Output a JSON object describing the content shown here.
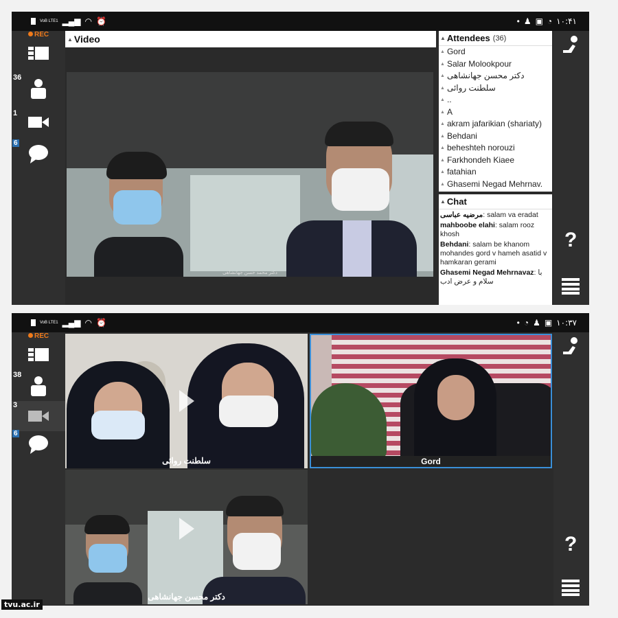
{
  "screenshot1": {
    "status_time": "۱۰:۴۱",
    "status_network": "VoB LTE1",
    "rec_label": "REC",
    "sidebar": {
      "attendee_count": "36",
      "camera_count": "1",
      "chat_badge": "6"
    },
    "video_header": "Video",
    "video_caption": "دکتر محمد حسن جهانشاهی",
    "attendees": {
      "title": "Attendees",
      "count": "(36)",
      "items": [
        "Gord",
        "Salar Molookpour",
        "دکتر محسن جهانشاهی",
        "سلطنت روائی",
        "..",
        "A",
        "akram jafarikian (shariaty)",
        "Behdani",
        "beheshteh norouzi",
        "Farkhondeh Kiaee",
        "fatahian",
        "Ghasemi Negad Mehrnav."
      ]
    },
    "chat": {
      "title": "Chat",
      "messages": [
        {
          "user": "مرضیه عباسی",
          "text": ": salam va eradat"
        },
        {
          "user": "mahboobe elahi",
          "text": ": salam rooz khosh"
        },
        {
          "user": "Behdani",
          "text": ": salam be khanom mohandes gord v hameh asatid v hamkaran gerami"
        },
        {
          "user": "Ghasemi Negad Mehrnavaz",
          "text": ": با سلام و عرض ادب"
        }
      ]
    }
  },
  "screenshot2": {
    "status_time": "۱۰:۳۷",
    "status_network": "VoB LTE1",
    "rec_label": "REC",
    "sidebar": {
      "attendee_count": "38",
      "camera_count": "3",
      "chat_badge": "6"
    },
    "tiles": [
      {
        "label": "سلطنت روائی"
      },
      {
        "label": "Gord"
      },
      {
        "label": "دکتر محسن جهانشاهی"
      }
    ]
  },
  "icons": {
    "layout": "layout-icon",
    "people": "person-icon",
    "camera": "camera-icon",
    "chat": "chat-bubble-icon",
    "hand": "raise-hand-icon",
    "help": "question-mark-icon",
    "menu": "hamburger-menu-icon"
  },
  "colors": {
    "rec": "#f07a1a",
    "badge": "#2a6fb0",
    "selected_tile_border": "#3a8fd8",
    "dark_ui": "#2f2f2f"
  },
  "watermark": "tvu.ac.ir"
}
